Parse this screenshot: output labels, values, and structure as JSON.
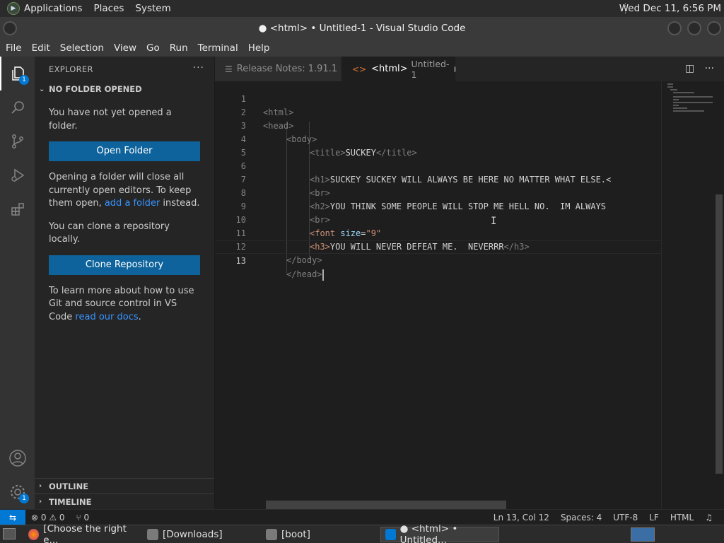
{
  "top_panel": {
    "menus": [
      "Applications",
      "Places",
      "System"
    ],
    "clock": "Wed Dec 11,  6:56 PM"
  },
  "window": {
    "title": "● <html> • Untitled-1 - Visual Studio Code"
  },
  "menubar": {
    "items": [
      "File",
      "Edit",
      "Selection",
      "View",
      "Go",
      "Run",
      "Terminal",
      "Help"
    ]
  },
  "activity_bar": {
    "explorer_badge": "1",
    "settings_badge": "1"
  },
  "sidebar": {
    "header": "EXPLORER",
    "section": "NO FOLDER OPENED",
    "msg_no_folder": "You have not yet opened a folder.",
    "open_folder_button": "Open Folder",
    "msg_close_pre": "Opening a folder will close all currently open editors. To keep them open, ",
    "msg_close_link": "add a folder",
    "msg_close_post": " instead.",
    "msg_clone": "You can clone a repository locally.",
    "clone_button": "Clone Repository",
    "msg_git_pre": "To learn more about how to use Git and source control in VS Code ",
    "msg_git_link": "read our docs",
    "msg_git_post": ".",
    "outline": "OUTLINE",
    "timeline": "TIMELINE"
  },
  "tabs": [
    {
      "label": "Release Notes: 1.91.1",
      "active": false
    },
    {
      "label": "<html>",
      "sublabel": "Untitled-1",
      "active": true,
      "dirty": true
    }
  ],
  "editor": {
    "line_numbers": [
      "1",
      "2",
      "3",
      "4",
      "5",
      "6",
      "7",
      "8",
      "9",
      "10",
      "11",
      "12",
      "13"
    ],
    "lines": {
      "l1": "<html>",
      "l2": "<head>",
      "l3": "<body>",
      "l4_open": "<title>",
      "l4_text": "SUCKEY",
      "l4_close": "</title>",
      "l6_open": "<h1>",
      "l6_text": "SUCKEY SUCKEY WILL ALWAYS BE HERE NO MATTER WHAT ELSE.<",
      "l7": "<br>",
      "l8_open": "<h2>",
      "l8_text": "YOU THINK SOME PEOPLE WILL STOP ME HELL NO.  IM ALWAYS",
      "l9": "<br>",
      "l10_tag": "<font",
      "l10_attr": " size",
      "l10_eq": "=",
      "l10_str": "\"9\"",
      "l11_open": "<h3>",
      "l11_text": "YOU WILL NEVER DEFEAT ME.  NEVERRR",
      "l11_close": "</h3>",
      "l12": "</body>",
      "l13": "</head>"
    }
  },
  "statusbar": {
    "problems": "⊗ 0 ⚠ 0",
    "ports": "⑂ 0",
    "position": "Ln 13, Col 12",
    "spaces": "Spaces: 4",
    "encoding": "UTF-8",
    "eol": "LF",
    "language": "HTML"
  },
  "taskbar": {
    "items": [
      "[Choose the right e...",
      "[Downloads]",
      "[boot]",
      "● <html> • Untitled..."
    ]
  }
}
